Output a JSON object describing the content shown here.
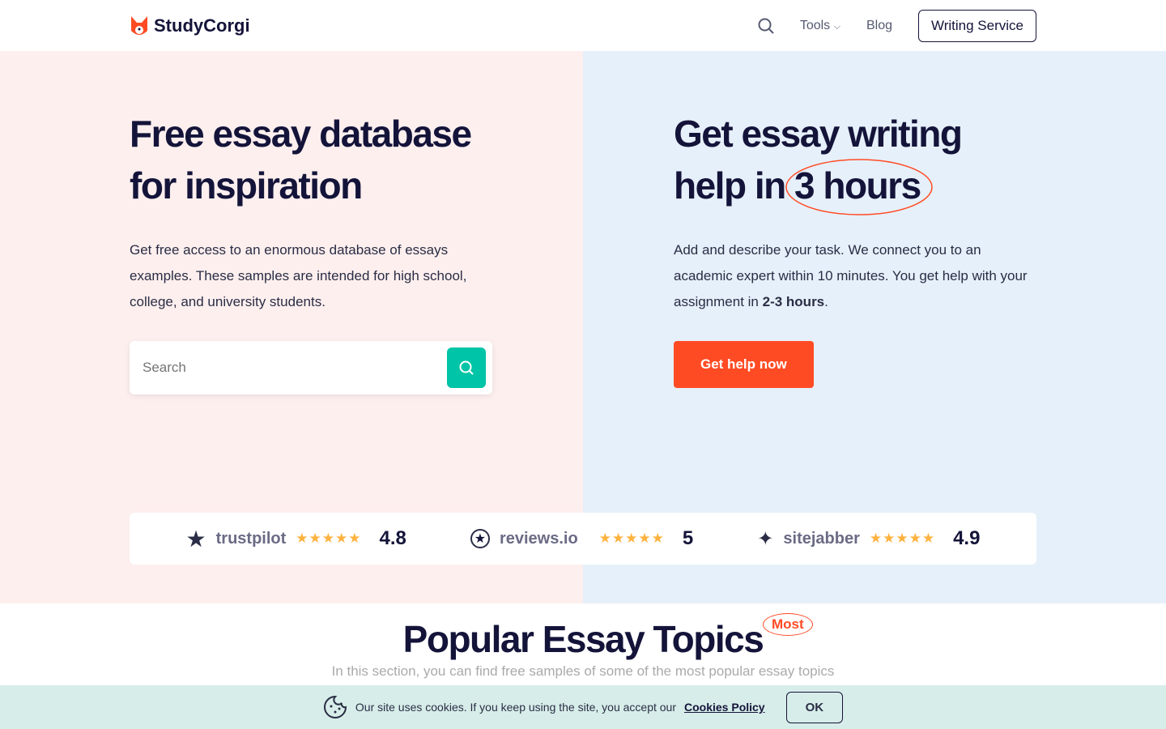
{
  "header": {
    "brand": "StudyCorgi",
    "nav": {
      "tools": "Tools",
      "blog": "Blog",
      "writing_service": "Writing Service"
    }
  },
  "left": {
    "title": "Free essay database for inspiration",
    "desc": "Get free access to an enormous database of essays examples. These samples are intended for high school, college, and university students.",
    "search_placeholder": "Search"
  },
  "right": {
    "title_a": "Get essay writing help in",
    "title_b": "3 hours",
    "desc_a": "Add and describe your task. We connect you to an academic expert within 10 minutes. You get help with your assignment in ",
    "desc_bold": "2-3 hours",
    "desc_end": ".",
    "cta": "Get help now"
  },
  "ratings": [
    {
      "name": "trustpilot",
      "score": "4.8",
      "stars": 4.5
    },
    {
      "name": "reviews.io",
      "score": "5",
      "stars": 5
    },
    {
      "name": "sitejabber",
      "score": "4.9",
      "stars": 4.5
    }
  ],
  "popular": {
    "title": "Popular Essay Topics",
    "badge": "Most",
    "subtitle": "In this section, you can find free samples of some of the most popular essay topics"
  },
  "cookie": {
    "text": "Our site uses cookies. If you keep using the site, you accept our",
    "link": "Cookies Policy",
    "ok": "OK"
  },
  "colors": {
    "accent": "#ff4b24",
    "teal": "#00c4a7",
    "navy": "#14143a"
  }
}
